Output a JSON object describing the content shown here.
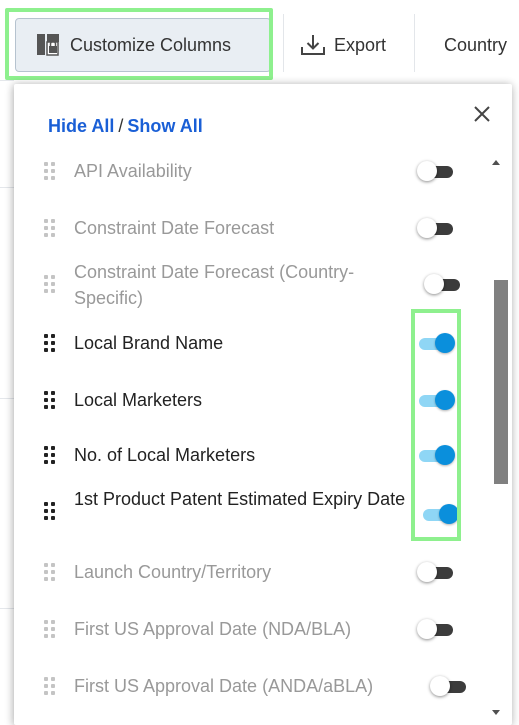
{
  "toolbar": {
    "customize_label": "Customize Columns",
    "export_label": "Export",
    "country_label": "Country"
  },
  "panel": {
    "hide_all": "Hide All",
    "separator": "/",
    "show_all": "Show All",
    "items": [
      {
        "label": "API Availability",
        "enabled": false
      },
      {
        "label": "Constraint Date Forecast",
        "enabled": false
      },
      {
        "label": "Constraint Date Forecast (Country-Specific)",
        "enabled": false
      },
      {
        "label": "Local Brand Name",
        "enabled": true
      },
      {
        "label": "Local Marketers",
        "enabled": true
      },
      {
        "label": "No. of Local Marketers",
        "enabled": true
      },
      {
        "label": "1st Product Patent Estimated Expiry Date",
        "enabled": true
      },
      {
        "label": "Launch Country/Territory",
        "enabled": false
      },
      {
        "label": "First US Approval Date (NDA/BLA)",
        "enabled": false
      },
      {
        "label": "First US Approval Date (ANDA/aBLA)",
        "enabled": false
      }
    ]
  },
  "colors": {
    "link": "#1a5fd6",
    "toggle_on": "#0a8fdc",
    "highlight": "#8ef08e"
  }
}
